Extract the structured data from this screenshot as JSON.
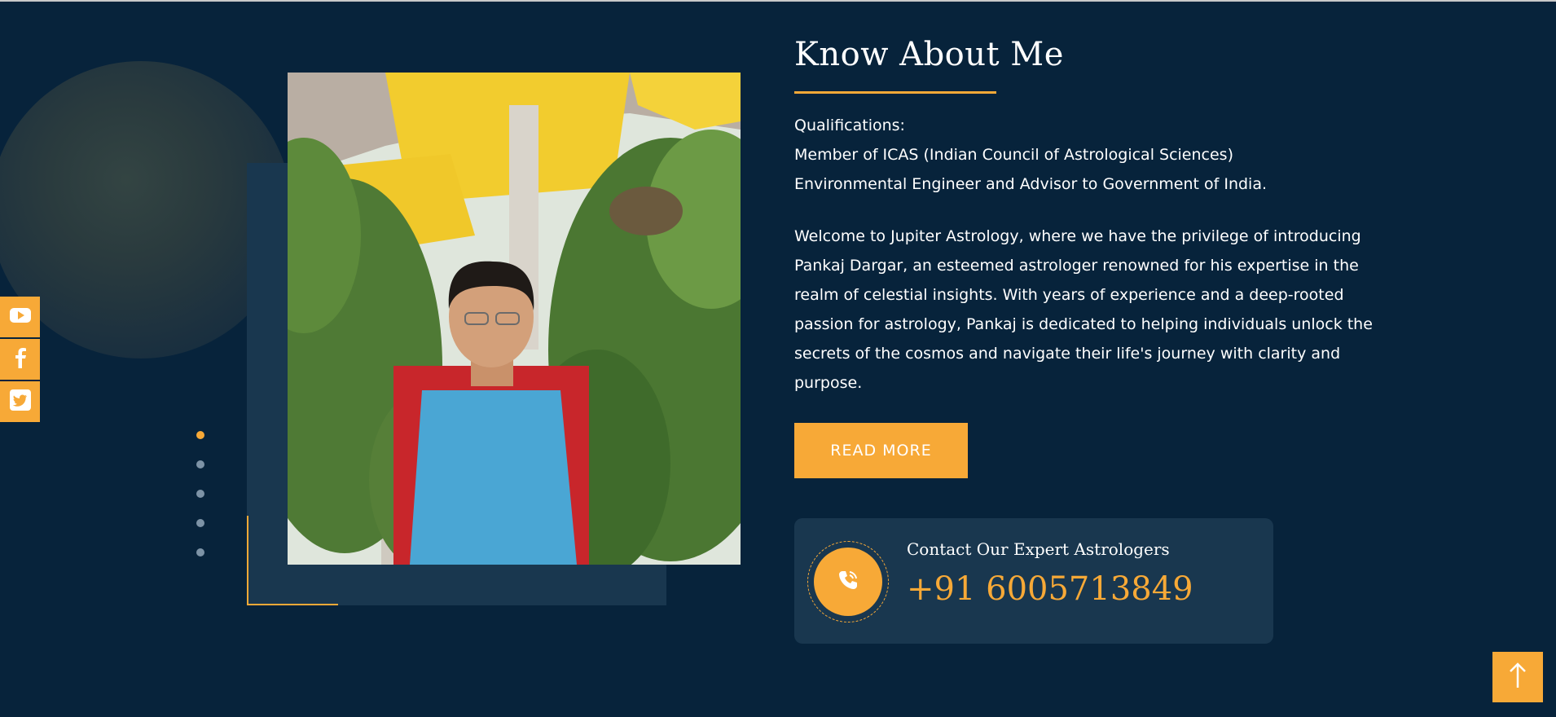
{
  "about": {
    "heading": "Know About Me",
    "qualifications": [
      "Qualifications:",
      "Member of ICAS (Indian Council of Astrological Sciences)",
      "Environmental Engineer and Advisor to Government of India."
    ],
    "description": "Welcome to Jupiter Astrology, where we have the privilege of introducing Pankaj Dargar, an esteemed astrologer renowned for his expertise in the realm of celestial insights. With years of experience and a deep-rooted passion for astrology, Pankaj is dedicated to helping individuals unlock the secrets of the cosmos and navigate their life's journey with clarity and purpose.",
    "read_more_label": "READ MORE"
  },
  "contact": {
    "title": "Contact Our Expert Astrologers",
    "phone": "+91 6005713849"
  },
  "social": {
    "items": [
      "youtube-icon",
      "facebook-icon",
      "twitter-icon"
    ]
  },
  "slider": {
    "dot_count": 5,
    "active_index": 0
  },
  "colors": {
    "background": "#07233b",
    "panel": "#19374f",
    "accent": "#f7a937",
    "text": "#ffffff"
  }
}
